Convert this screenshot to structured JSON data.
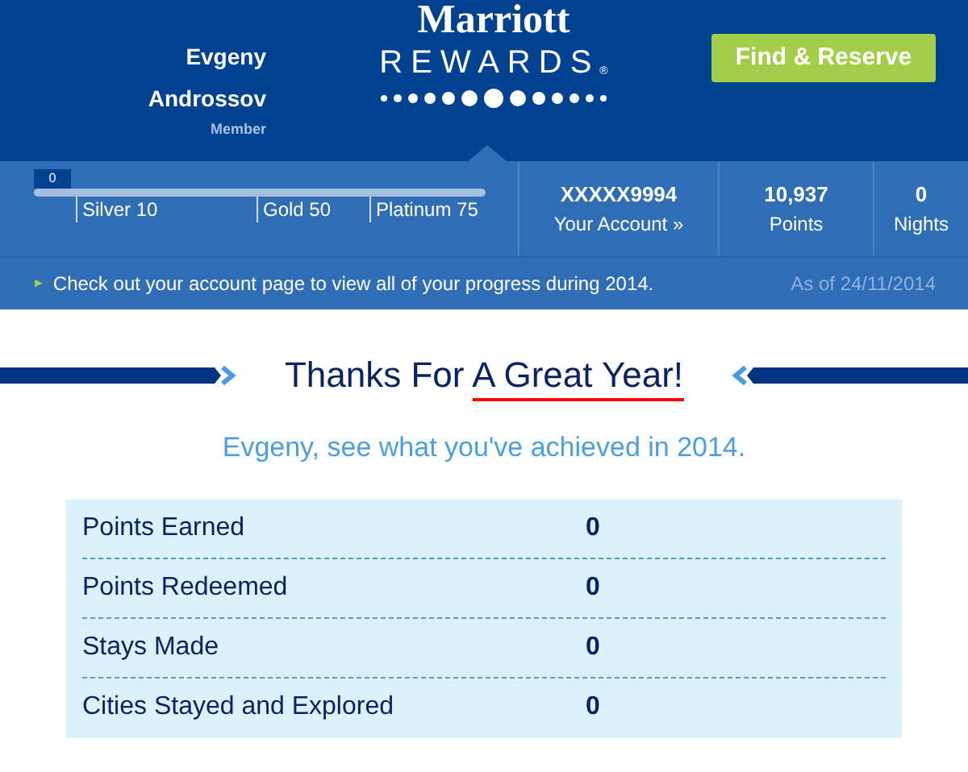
{
  "member": {
    "first_name": "Evgeny",
    "last_name": "Androssov",
    "status": "Member"
  },
  "logo": {
    "brand": "Marriott",
    "program": "REWARDS",
    "mark": "®"
  },
  "find_button": "Find & Reserve",
  "progress": {
    "flag": "0",
    "level": 0,
    "tiers": [
      "Silver 10",
      "Gold 50",
      "Platinum 75"
    ]
  },
  "account": {
    "number": "XXXXX9994",
    "link": "Your Account »"
  },
  "stats": [
    {
      "value": "10,937",
      "label": "Points"
    },
    {
      "value": "0",
      "label": "Nights"
    }
  ],
  "notice": {
    "arrow": "►",
    "text": "Check out your account page to view all of your progress during 2014.",
    "date": "As of 24/11/2014"
  },
  "title": {
    "lead": "Thanks For ",
    "highlight": "A Great Year!"
  },
  "subtitle": "Evgeny, see what you've achieved in 2014.",
  "summary": [
    {
      "label": "Points Earned",
      "value": "0"
    },
    {
      "label": "Points Redeemed",
      "value": "0"
    },
    {
      "label": "Stays Made",
      "value": "0"
    },
    {
      "label": "Cities Stayed and Explored",
      "value": "0"
    }
  ]
}
